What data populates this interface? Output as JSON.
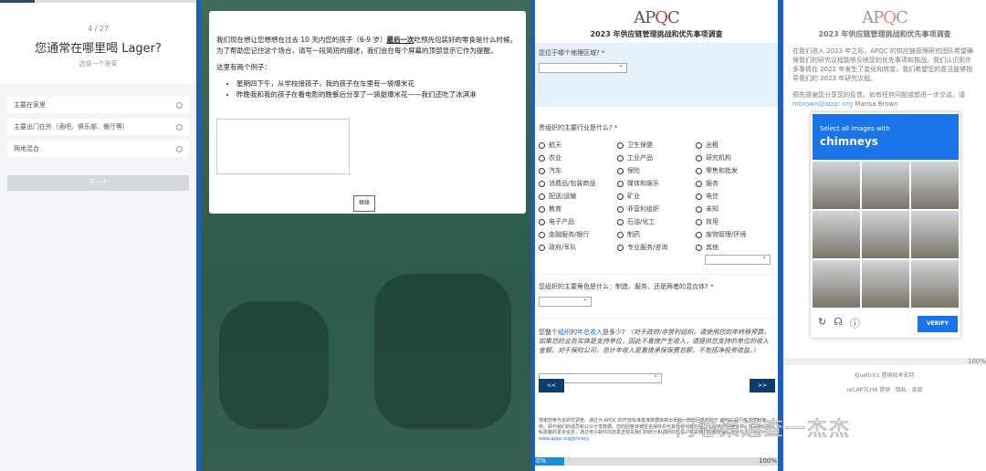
{
  "panel1": {
    "counter": "4 / 27",
    "question": "您通常在哪里喝 Lager?",
    "hint": "选择一个答案",
    "options": [
      "主要在家里",
      "主要出门在外（酒吧、俱乐部、餐厅等）",
      "两地混合"
    ],
    "next": "下一个"
  },
  "panel2": {
    "intro_a": "我们现在想让您想想在过去 10 天内您的孩子（6-9 岁）",
    "intro_bold": "最后一次",
    "intro_b": "吃预先包装好的零食是什么时候。为了帮助您记住这个场合，请写一段简短的描述，我们会在每个屏幕的顶部显示它作为提醒。",
    "examples_label": "这里有两个例子：",
    "examples": [
      "星期四下午，从学校接孩子，我的孩子在车里有一袋爆米花",
      "昨晚我和我的孩子在看电影的晚餐后分享了一袋甜爆米花——我们还吃了冰淇淋"
    ],
    "continue": "继续"
  },
  "panel3": {
    "logo": "APQC",
    "title": "2023 年供应链管理挑战和优先事项调查",
    "q_region": "您位于哪个地理区域? *",
    "q_industry": "贵组织的主要行业是什么? *",
    "industries": [
      "航天",
      "卫生保健",
      "出租",
      "农业",
      "工业产品",
      "研究机构",
      "汽车",
      "保险",
      "零售和批发",
      "消费品/包装商品",
      "媒体和娱乐",
      "服务",
      "配送/运输",
      "矿业",
      "电信",
      "教育",
      "非营利组织",
      "未知",
      "电子产品",
      "石油/化工",
      "效用",
      "金融服务/银行",
      "制药",
      "废物管理/环境",
      "政府/军队",
      "专业服务/咨询",
      "其他"
    ],
    "q_role": "您组织的主要角色是什么：制造、服务、还是两者的混合体? *",
    "q_rev_a": "您整个",
    "q_rev_link1": "组织",
    "q_rev_b": "的",
    "q_rev_link2": "年总收入",
    "q_rev_c": "是多少?",
    "q_rev_note": "（对于政府/非营利组织，请使用您的年转移预算。如果您的业务实体是支持单位，因此不直接产生收入，请提供您支持的单位的收入金额。对于保险公司，总计年收入是直接承保保费总额，不包括净投资收益。）",
    "back": "<<",
    "forward": ">>",
    "footer": "感谢您参与本研究调查。通过为 APQC 的开放标准基准数据库做出贡献，您的回答有助于 APQC 履行其非营利使命。即与我们的成员和公众分享数据。您的回答将被匿名保存并与其他参与者在报告中提供的数据合并。有关我们隐私政策的更多信息，通过电子邮件向您发送有关我们的统计和调研的信息，有关我们隐私政策的更多信息，请访问",
    "footer_link": "www.apqc.org/privacy",
    "prog_start": "0%",
    "prog_end": "100%"
  },
  "panel4": {
    "logo": "APQC",
    "title": "2023 年供应链管理挑战和优先事项调查",
    "para1": "在我们进入 2023 年之际，APQC 的供应链管理研究团队希望确保我们的研究议程能够反映您的优先事项和挑战。我们认识到许多事情在 2022 年发生了变化和转变，我们希望您的意见能够指导我们的 2023 年研究议程。",
    "para2": "预先感谢您分享您的反馈。如有任何问题或想进一步交谈，请",
    "para2_link": "mbrown@apqc.org",
    "para2_name": "Marisa Brown",
    "captcha_prompt": "Select all images with",
    "captcha_target": "chimneys",
    "verify": "VERIFY",
    "prog_end": "100%",
    "qualtrics": "Qualtrics 提供技术支持",
    "recaptcha": "reCAPTCHA 提供 · 隐私 · 条款"
  },
  "watermark": "问卷渠道查一杰杰"
}
